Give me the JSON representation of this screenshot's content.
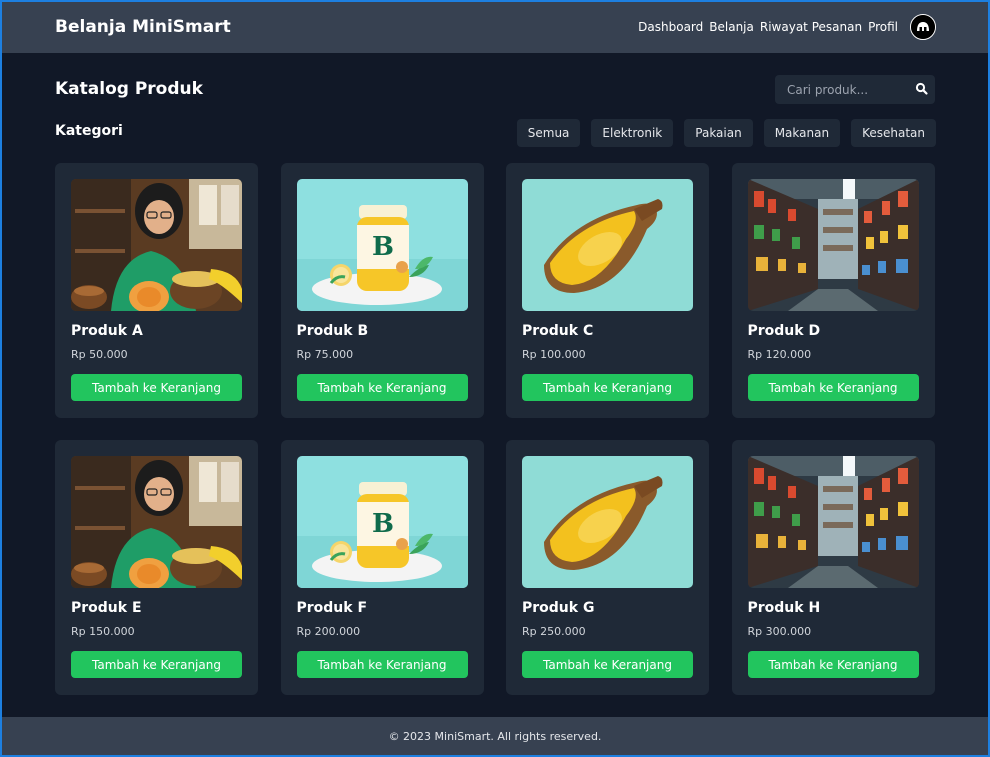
{
  "header": {
    "brand": "Belanja MiniSmart",
    "nav": [
      "Dashboard",
      "Belanja",
      "Riwayat Pesanan",
      "Profil"
    ]
  },
  "main": {
    "title": "Katalog Produk",
    "search": {
      "placeholder": "Cari produk..."
    },
    "category_title": "Kategori",
    "categories": [
      "Semua",
      "Elektronik",
      "Pakaian",
      "Makanan",
      "Kesehatan"
    ]
  },
  "products": [
    {
      "name": "Produk A",
      "price": "Rp 50.000",
      "button": "Tambah ke Keranjang",
      "image": "woman-with-fruit-basket"
    },
    {
      "name": "Produk B",
      "price": "Rp 75.000",
      "button": "Tambah ke Keranjang",
      "image": "honey-jar-b"
    },
    {
      "name": "Produk C",
      "price": "Rp 100.000",
      "button": "Tambah ke Keranjang",
      "image": "yellow-fruit-slice"
    },
    {
      "name": "Produk D",
      "price": "Rp 120.000",
      "button": "Tambah ke Keranjang",
      "image": "supermarket-aisle"
    },
    {
      "name": "Produk E",
      "price": "Rp 150.000",
      "button": "Tambah ke Keranjang",
      "image": "woman-with-fruit-basket"
    },
    {
      "name": "Produk F",
      "price": "Rp 200.000",
      "button": "Tambah ke Keranjang",
      "image": "honey-jar-b"
    },
    {
      "name": "Produk G",
      "price": "Rp 250.000",
      "button": "Tambah ke Keranjang",
      "image": "yellow-fruit-slice"
    },
    {
      "name": "Produk H",
      "price": "Rp 300.000",
      "button": "Tambah ke Keranjang",
      "image": "supermarket-aisle"
    }
  ],
  "jar_label": "B",
  "footer": {
    "text": "© 2023 MiniSmart. All rights reserved."
  },
  "colors": {
    "accent": "#22c55e",
    "header": "#374151",
    "background": "#111827",
    "card": "#1f2937"
  }
}
